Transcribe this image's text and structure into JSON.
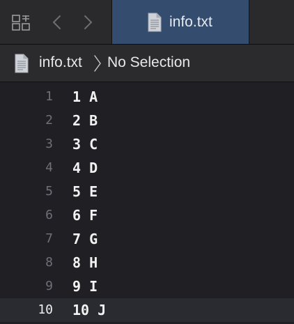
{
  "tabbar": {
    "grid_icon": "related-items-grid-icon",
    "back_icon": "chevron-left-icon",
    "forward_icon": "chevron-right-icon",
    "tab": {
      "label": "info.txt",
      "icon": "text-document-icon"
    }
  },
  "jumpbar": {
    "file_icon": "text-document-icon",
    "file_label": "info.txt",
    "separator_icon": "chevron-right-icon",
    "selection_label": "No Selection"
  },
  "editor": {
    "current_line": 10,
    "lines": [
      {
        "number": "1",
        "text": "1 A"
      },
      {
        "number": "2",
        "text": "2 B"
      },
      {
        "number": "3",
        "text": "3 C"
      },
      {
        "number": "4",
        "text": "4 D"
      },
      {
        "number": "5",
        "text": "5 E"
      },
      {
        "number": "6",
        "text": "6 F"
      },
      {
        "number": "7",
        "text": "7 G"
      },
      {
        "number": "8",
        "text": "8 H"
      },
      {
        "number": "9",
        "text": "9 I"
      },
      {
        "number": "10",
        "text": "10 J"
      }
    ]
  },
  "colors": {
    "tab_active": "#344c6e",
    "editor_background": "#1f1f24",
    "current_line_highlight": "#2a2b30",
    "line_number": "#6f7177",
    "code_text": "#f2f2f2"
  }
}
